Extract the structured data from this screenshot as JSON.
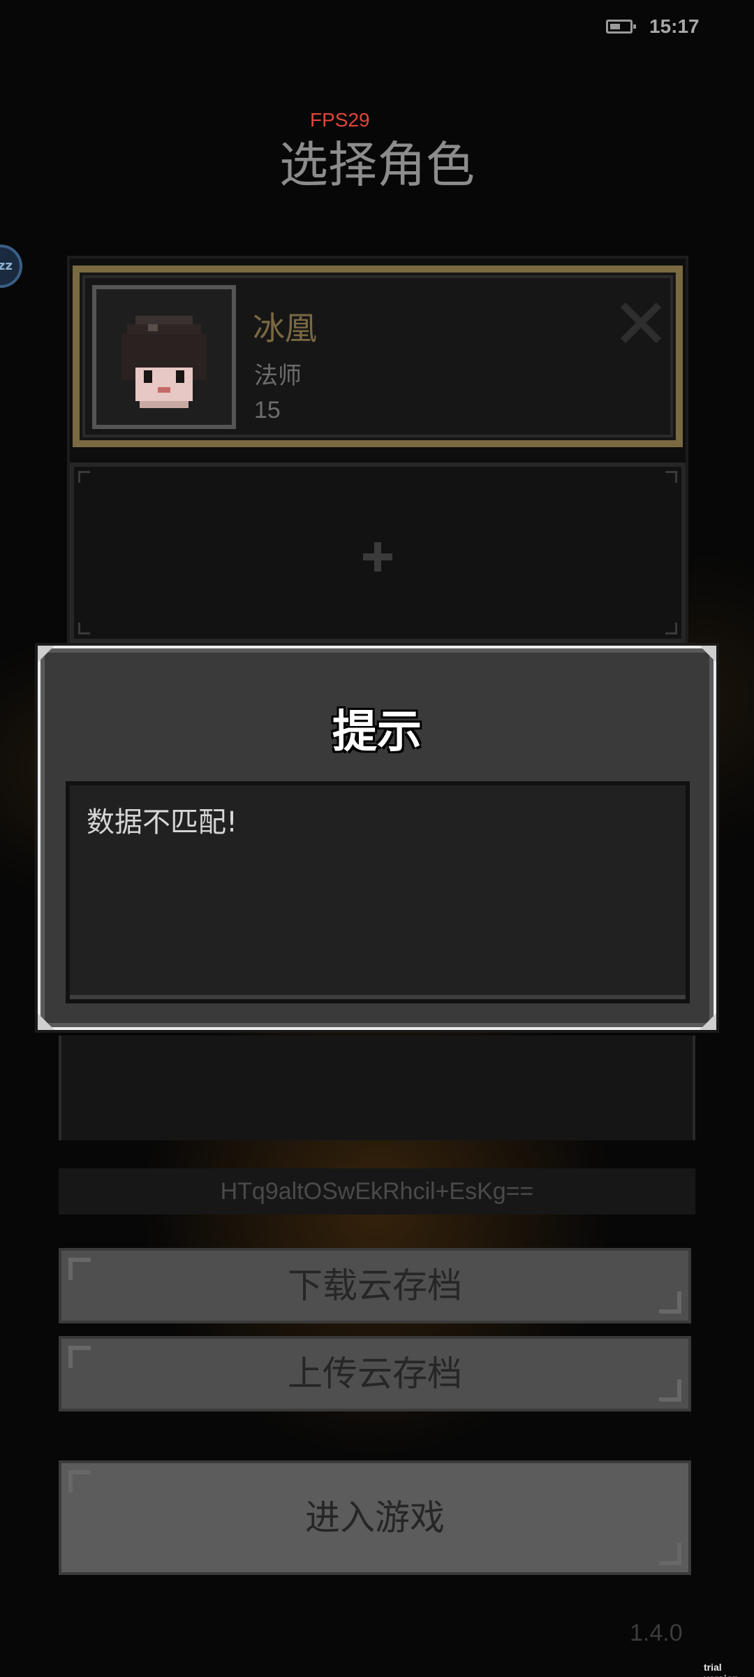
{
  "status_bar": {
    "time": "15:17",
    "battery_icon": "battery-low-icon"
  },
  "overlay": {
    "fps": "FPS29"
  },
  "header": {
    "title": "选择角色"
  },
  "characters": [
    {
      "name": "冰凰",
      "class": "法师",
      "level": "15",
      "selected": true,
      "accent_color": "#7a6a42"
    }
  ],
  "empty_slot": {
    "icon": "plus-icon"
  },
  "sync_code": "HTq9altOSwEkRhcil+EsKg==",
  "buttons": {
    "download": "下载云存档",
    "upload": "上传云存档",
    "enter_game": "进入游戏"
  },
  "version": "1.4.0",
  "watermark": "trial version",
  "dialog": {
    "title": "提示",
    "message": "数据不匹配!"
  },
  "colors": {
    "background": "#070707",
    "selected_border": "#7a6a42",
    "fps": "#e0463b"
  }
}
